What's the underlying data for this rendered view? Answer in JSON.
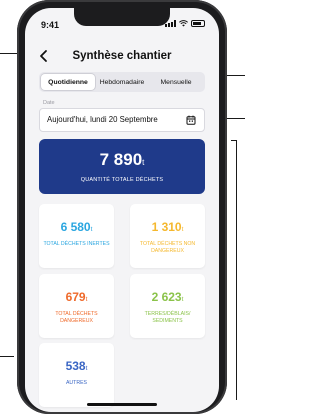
{
  "status_bar": {
    "time": "9:41"
  },
  "header": {
    "title": "Synthèse chantier"
  },
  "period_tabs": [
    {
      "label": "Quotidienne",
      "active": true
    },
    {
      "label": "Hebdomadaire",
      "active": false
    },
    {
      "label": "Mensuelle",
      "active": false
    }
  ],
  "date_field": {
    "label": "Date",
    "value": "Aujourd'hui, lundi 20 Septembre"
  },
  "total": {
    "value": "7 890",
    "unit": "t",
    "label": "QUANTITÉ TOTALE DÉCHETS",
    "color": "#1f3a8a"
  },
  "stats": [
    {
      "value": "6 580",
      "unit": "t",
      "label": "TOTAL DÉCHETS INERTES",
      "color": "#2aa6e0"
    },
    {
      "value": "1 310",
      "unit": "t",
      "label": "TOTAL DÉCHETS NON DANGEREUX",
      "color": "#f5b82e"
    },
    {
      "value": "679",
      "unit": "t",
      "label": "TOTAL DÉCHETS DANGEREUX",
      "color": "#ef6a2b"
    },
    {
      "value": "2 623",
      "unit": "t",
      "label": "TERRES/DÉBLAIS/ SEDIMENTS",
      "color": "#8bc34a"
    },
    {
      "value": "538",
      "unit": "t",
      "label": "AUTRES",
      "color": "#3a66c4"
    }
  ]
}
